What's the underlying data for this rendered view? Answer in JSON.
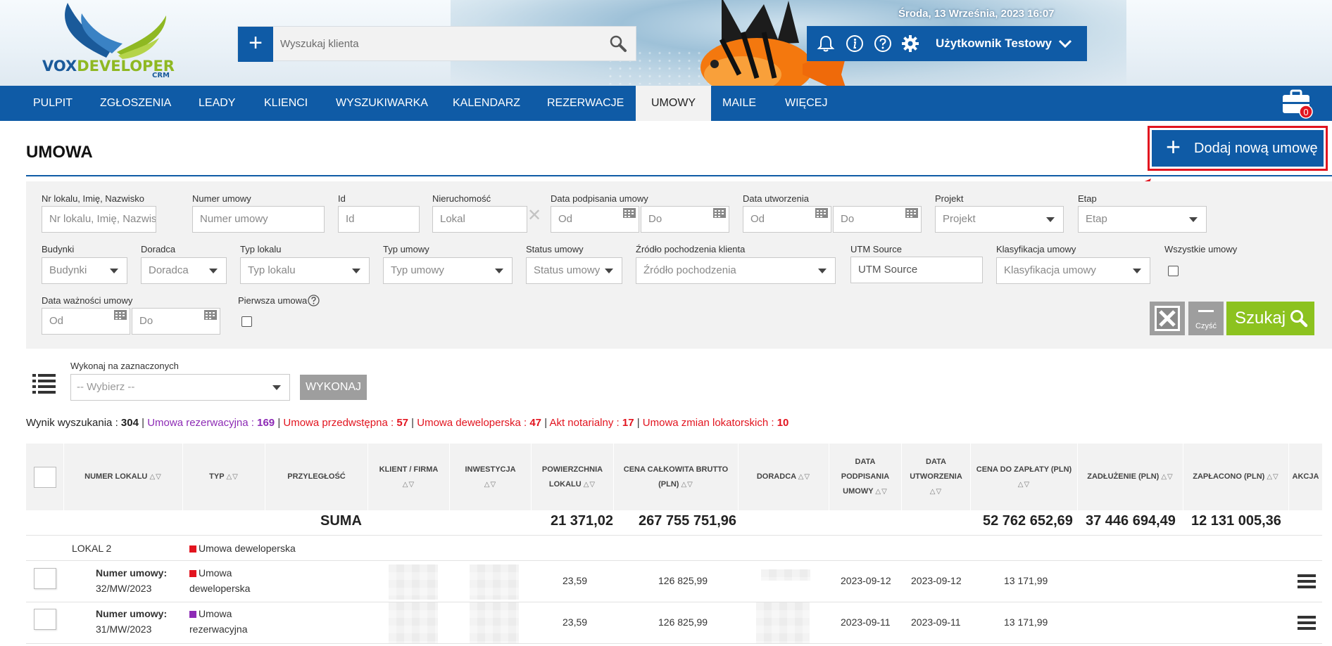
{
  "header": {
    "logo_text_vox": "VOX",
    "logo_text_dev": "DEVELOPER",
    "logo_crm": "CRM",
    "datetime": "Środa, 13 Września, 2023   16:07",
    "search": {
      "placeholder": "Wyszukaj klienta"
    },
    "user_name": "Użytkownik Testowy"
  },
  "nav": {
    "items": [
      "PULPIT",
      "ZGŁOSZENIA",
      "LEADY",
      "KLIENCI",
      "WYSZUKIWARKA",
      "KALENDARZ",
      "REZERWACJE",
      "UMOWY",
      "MAILE",
      "WIĘCEJ"
    ],
    "active": "UMOWY",
    "briefcase_badge": "0"
  },
  "page": {
    "title": "UMOWA",
    "add_button": "Dodaj nową umowę"
  },
  "filters": {
    "row1": {
      "nr_lokalu": {
        "label": "Nr lokalu, Imię, Nazwisko",
        "placeholder": "Nr lokalu, Imię, Nazwisko"
      },
      "numer_umowy": {
        "label": "Numer umowy",
        "placeholder": "Numer umowy"
      },
      "id": {
        "label": "Id",
        "placeholder": "Id"
      },
      "nieruchomosc": {
        "label": "Nieruchomość",
        "placeholder": "Lokal"
      },
      "data_podpisania": {
        "label": "Data podpisania umowy",
        "od": "Od",
        "do": "Do"
      },
      "data_utworzenia": {
        "label": "Data utworzenia",
        "od": "Od",
        "do": "Do"
      },
      "projekt": {
        "label": "Projekt",
        "value": "Projekt"
      },
      "etap": {
        "label": "Etap",
        "value": "Etap"
      }
    },
    "row2": {
      "budynki": {
        "label": "Budynki",
        "value": "Budynki"
      },
      "doradca": {
        "label": "Doradca",
        "value": "Doradca"
      },
      "typ_lokalu": {
        "label": "Typ lokalu",
        "value": "Typ lokalu"
      },
      "typ_umowy": {
        "label": "Typ umowy",
        "value": "Typ umowy"
      },
      "status_umowy": {
        "label": "Status umowy",
        "value": "Status umowy"
      },
      "zrodlo": {
        "label": "Źródło pochodzenia klienta",
        "value": "Źródło pochodzenia"
      },
      "utm": {
        "label": "UTM Source",
        "placeholder": "UTM Source"
      },
      "klasyfikacja": {
        "label": "Klasyfikacja umowy",
        "value": "Klasyfikacja umowy"
      },
      "wszystkie": {
        "label": "Wszystkie umowy"
      }
    },
    "row3": {
      "data_waznosci": {
        "label": "Data ważności umowy",
        "od": "Od",
        "do": "Do"
      },
      "pierwsza": {
        "label": "Pierwsza umowa"
      }
    },
    "buttons": {
      "clear": "Czyść",
      "search": "Szukaj"
    }
  },
  "bulk": {
    "label": "Wykonaj na zaznaczonych",
    "select": "-- Wybierz --",
    "execute": "WYKONAJ"
  },
  "summary": {
    "total_label": "Wynik wyszukania",
    "total": "304",
    "items": [
      {
        "label": "Umowa rezerwacyjna",
        "count": "169",
        "color": "#8d2bb5"
      },
      {
        "label": "Umowa przedwstępna",
        "count": "57",
        "color": "#e2141f"
      },
      {
        "label": "Umowa deweloperska",
        "count": "47",
        "color": "#e2141f"
      },
      {
        "label": "Akt notarialny",
        "count": "17",
        "color": "#e2141f"
      },
      {
        "label": "Umowa zmian lokatorskich",
        "count": "10",
        "color": "#e2141f"
      }
    ]
  },
  "table": {
    "headers": {
      "numer_lokalu": "NUMER LOKALU",
      "typ": "TYP",
      "przyleglosc": "PRZYLEGŁOŚĆ",
      "klient": "KLIENT / FIRMA",
      "inwestycja": "INWESTYCJA",
      "powierzchnia_1": "POWIERZCHNIA",
      "powierzchnia_2": "LOKALU",
      "cena_1": "CENA CAŁKOWITA BRUTTO",
      "cena_2": "(PLN)",
      "doradca": "DORADCA",
      "data_podp_1": "DATA",
      "data_podp_2": "PODPISANIA",
      "data_podp_3": "UMOWY",
      "data_utw_1": "DATA",
      "data_utw_2": "UTWORZENIA",
      "cena_zaplaty": "CENA DO ZAPŁATY (PLN)",
      "zadluzenie": "ZADŁUŻENIE (PLN)",
      "zaplacono": "ZAPŁACONO (PLN)",
      "akcja": "AKCJA"
    },
    "sum": {
      "label": "SUMA",
      "powierzchnia": "21 371,02",
      "cena": "267 755 751,96",
      "cena_zaplaty": "52 762 652,69",
      "zadluzenie": "37 446 694,49",
      "zaplacono": "12 131 005,36"
    },
    "group_row": {
      "lokal": "LOKAL 2",
      "typ": "Umowa deweloperska",
      "typ_color": "#e2141f"
    },
    "rows": [
      {
        "numer_label": "Numer umowy:",
        "numer": "32/MW/2023",
        "typ_1": "Umowa",
        "typ_2": "deweloperska",
        "typ_color": "#e2141f",
        "powierzchnia": "23,59",
        "cena": "126 825,99",
        "data_podp": "2023-09-12",
        "data_utw": "2023-09-12",
        "cena_zaplaty": "13 171,99"
      },
      {
        "numer_label": "Numer umowy:",
        "numer": "31/MW/2023",
        "typ_1": "Umowa",
        "typ_2": "rezerwacyjna",
        "typ_color": "#8d2bb5",
        "powierzchnia": "23,59",
        "cena": "126 825,99",
        "data_podp": "2023-09-11",
        "data_utw": "2023-09-11",
        "cena_zaplaty": "13 171,99"
      }
    ]
  },
  "colors": {
    "brand_blue": "#0f5ba6",
    "green": "#8cc21f",
    "red": "#e2141f",
    "purple": "#8d2bb5"
  },
  "icons": [
    "plus-icon",
    "search-icon",
    "bell-icon",
    "info-icon",
    "help-icon",
    "gear-icon",
    "chevron-down-icon",
    "briefcase-icon",
    "calendar-icon",
    "excel-icon",
    "list-icon",
    "menu-icon",
    "red-arrow"
  ]
}
